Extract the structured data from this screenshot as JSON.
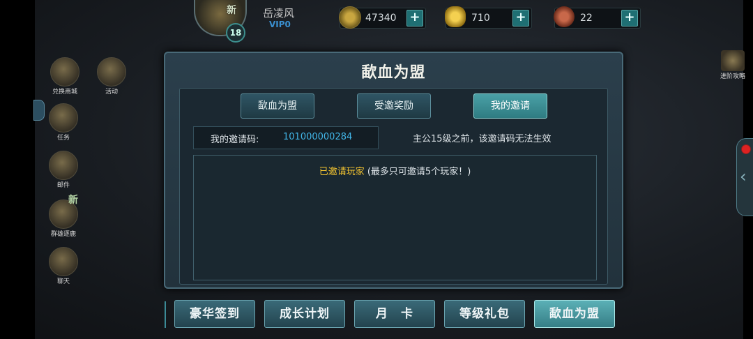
{
  "player": {
    "name": "岳凌风",
    "vip": "VIP0",
    "level": "18",
    "new_badge": "新"
  },
  "resources": [
    {
      "icon": "copper-coin-icon",
      "value": "47340",
      "plus": "+"
    },
    {
      "icon": "gold-ingot-icon",
      "value": "710",
      "plus": "+"
    },
    {
      "icon": "meat-food-icon",
      "value": "22",
      "plus": "+"
    }
  ],
  "left_menu": [
    {
      "icon": "exchange-shop-icon",
      "label": "兑换商城"
    },
    {
      "icon": "activity-scroll-icon",
      "label": "活动"
    },
    {
      "icon": "quest-scroll-icon",
      "label": "任务"
    },
    {
      "icon": "mail-icon",
      "label": "邮件"
    },
    {
      "icon": "heroes-battle-icon",
      "label": "群雄逐鹿",
      "badge": "新"
    },
    {
      "icon": "chat-icon",
      "label": "聊天"
    }
  ],
  "right": {
    "strategy_label": "进阶攻略",
    "handle_glyph": "‹"
  },
  "dialog": {
    "title": "歃血为盟",
    "tabs": [
      {
        "label": "歃血为盟",
        "active": false
      },
      {
        "label": "受邀奖励",
        "active": false
      },
      {
        "label": "我的邀请",
        "active": true
      }
    ],
    "invite_code_label": "我的邀请码:",
    "invite_code_value": "101000000284",
    "invite_note": "主公15级之前，该邀请码无法生效",
    "invited_title": "已邀请玩家",
    "invited_note": "(最多只可邀请5个玩家！)"
  },
  "bottom_buttons": [
    {
      "label": "豪华签到",
      "active": false
    },
    {
      "label": "成长计划",
      "active": false
    },
    {
      "label": "月　卡",
      "active": false
    },
    {
      "label": "等级礼包",
      "active": false
    },
    {
      "label": "歃血为盟",
      "active": true
    }
  ],
  "colors": {
    "accent_teal": "#3a8f94",
    "code_blue": "#42b6e8",
    "highlight_gold": "#f0c230",
    "vip_blue": "#3a8fd0"
  }
}
